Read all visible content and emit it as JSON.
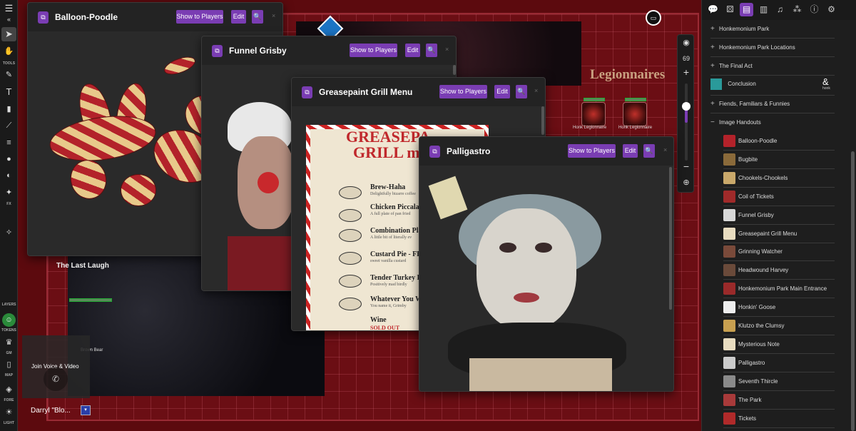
{
  "map": {
    "labels": {
      "last_laugh": "The Last Laugh",
      "legionnaires": "Legionnaires",
      "honk_legionnaire_1": "Honk Legionnaire",
      "honk_legionnaire_2": "Honk Legionnaire",
      "brown_bear": "Brown Bear"
    }
  },
  "toolbar": {
    "tools_label": "TOOLS",
    "fx_label": "FX",
    "layers_label": "LAYERS",
    "tokens_label": "TOKENS",
    "gm_label": "GM",
    "map_label": "MAP",
    "fore_label": "FORE",
    "light_label": "LIGHT"
  },
  "zoom": {
    "level": "69",
    "plus": "+",
    "minus": "−",
    "level_fraction": 0.7
  },
  "windows": [
    {
      "title": "Balloon-Poodle",
      "show_label": "Show to Players",
      "edit_label": "Edit",
      "close": "×"
    },
    {
      "title": "Funnel Grisby",
      "show_label": "Show to Players",
      "edit_label": "Edit",
      "close": "×"
    },
    {
      "title": "Greasepaint Grill Menu",
      "show_label": "Show to Players",
      "edit_label": "Edit",
      "close": "×"
    },
    {
      "title": "Palligastro",
      "show_label": "Show to Players",
      "edit_label": "Edit",
      "close": "×"
    }
  ],
  "menu_art": {
    "title_line1": "GREASEPA",
    "title_line2": "GRILL m",
    "items": [
      {
        "name": "Brew-Haha",
        "sub": "Delightfully bizarre coffee"
      },
      {
        "name": "Chicken Piccala",
        "sub": "A full plate of pan fried"
      },
      {
        "name": "Combination Plat",
        "sub": "A little bit of literally ev"
      },
      {
        "name": "Custard Pie - FRE",
        "sub": "sweet vanilla custard"
      },
      {
        "name": "Tender Turkey E",
        "sub": "Positively mad birdly"
      },
      {
        "name": "Whatever You W",
        "sub": "You name it, Grimby"
      },
      {
        "name": "Wine",
        "sub": "SOLD OUT"
      }
    ]
  },
  "sidebar": {
    "folders": [
      {
        "label": "Honkemonium Park"
      },
      {
        "label": "Honkemonium Park Locations"
      },
      {
        "label": "The Final Act"
      }
    ],
    "conclusion": {
      "label": "Conclusion",
      "badge": "honk"
    },
    "folders2": [
      {
        "label": "Fiends, Familiars & Funnies"
      }
    ],
    "image_handouts": {
      "label": "Image Handouts",
      "toggle": "−"
    },
    "handouts": [
      {
        "label": "Balloon-Poodle",
        "color": "#b3222a"
      },
      {
        "label": "Bugbite",
        "color": "#8a6a3a"
      },
      {
        "label": "Chookels-Chookels",
        "color": "#c9a86a"
      },
      {
        "label": "Coil of Tickets",
        "color": "#a02a2a"
      },
      {
        "label": "Funnel Grisby",
        "color": "#d8d8d8"
      },
      {
        "label": "Greasepaint Grill Menu",
        "color": "#e8dcc0"
      },
      {
        "label": "Grinning Watcher",
        "color": "#7a4a3a"
      },
      {
        "label": "Headwound Harvey",
        "color": "#6a4a3a"
      },
      {
        "label": "Honkemonium Park Main Entrance",
        "color": "#9a2a2a"
      },
      {
        "label": "Honkin' Goose",
        "color": "#eeeeee"
      },
      {
        "label": "Klutzo the Clumsy",
        "color": "#c8a050"
      },
      {
        "label": "Mysterious Note",
        "color": "#e8dcc0"
      },
      {
        "label": "Palligastro",
        "color": "#cccccc"
      },
      {
        "label": "Seventh Thircle",
        "color": "#8a8a8a"
      },
      {
        "label": "The Park",
        "color": "#a83a3a"
      },
      {
        "label": "Tickets",
        "color": "#b02a2a"
      }
    ]
  },
  "player": {
    "voice_label": "Join Voice & Video",
    "name": "Darryl \"Blo...",
    "color": "#2a3fa8"
  }
}
